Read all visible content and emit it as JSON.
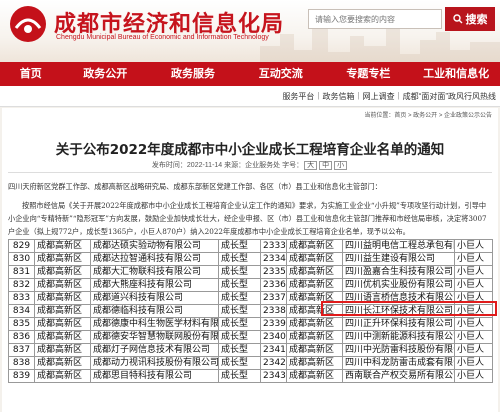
{
  "header": {
    "title": "成都市经济和信息化局",
    "subtitle": "Chengdu Municipal Bureau of Economic and Information Technology",
    "search_placeholder": "请输入您要搜索的内容",
    "search_button": "搜索"
  },
  "nav": [
    "首页",
    "政务公开",
    "政务服务",
    "互动交流",
    "专题专栏",
    "工业和信息化"
  ],
  "quick_links": [
    "服务平台",
    "政务信箱",
    "网上调查",
    "成都“面对面”政风行风热线"
  ],
  "breadcrumb": "当前位置：首页 > 政务公开 > 企业政策公示公告",
  "article": {
    "title": "关于公布2022年度成都市中小企业成长工程培育企业名单的通知",
    "meta_prefix": "发布时间：2022-11-14 来源：企业服务处 字号：",
    "font_sizes": [
      "大",
      "中",
      "小"
    ],
    "p1": "四川天府新区党群工作部、成都高新区战略研究局、成都东部新区党建工作部、各区（市）县工业和信息化主管部门：",
    "p2": "按照市经信局《关于开展2022年度成都市中小企业成长工程培育企业认定工作的通知》要求，为实施工业企业“小升规”专项攻坚行动计划，引导中小企业向“专精特新”“隐形冠军”方向发展，鼓励企业加快成长壮大，经企业申报、区（市）县工业和信息化主管部门推荐和市经信局审核，决定将3007户企业（拟上规772户，成长型1365户，小巨人870户）纳入2022年度成都市中小企业成长工程培育企业名单，现予以公布。"
  },
  "table": {
    "rows": [
      [
        "829",
        "成都高新区",
        "成都达硕实验动物有限公司",
        "成长型",
        "2333",
        "成都高新区",
        "四川益明电信工程总承包有限公司",
        "小巨人"
      ],
      [
        "830",
        "成都高新区",
        "成都达拉智通科技有限公司",
        "成长型",
        "2334",
        "成都高新区",
        "四川益生建设有限公司",
        "小巨人"
      ],
      [
        "831",
        "成都高新区",
        "成都大汇物联科技有限公司",
        "成长型",
        "2335",
        "成都高新区",
        "四川盈嘉合生科技有限公司",
        "小巨人"
      ],
      [
        "832",
        "成都高新区",
        "成都大熊座科技有限公司",
        "成长型",
        "2336",
        "成都高新区",
        "四川优机实业股份有限公司",
        "小巨人"
      ],
      [
        "833",
        "成都高新区",
        "成都道兴科技有限公司",
        "成长型",
        "2337",
        "成都高新区",
        "四川语言桥信息技术有限公司",
        "小巨人"
      ],
      [
        "834",
        "成都高新区",
        "成都德临科技有限公司",
        "成长型",
        "2338",
        "成都高新区",
        "四川长江环保技术有限公司",
        "小巨人"
      ],
      [
        "835",
        "成都高新区",
        "成都德康中科生物医学材料有限",
        "成长型",
        "2339",
        "成都高新区",
        "四川正升环保科技有限公司",
        "小巨人"
      ],
      [
        "836",
        "成都高新区",
        "成都德安华智慧物联网股份有限",
        "成长型",
        "2340",
        "成都高新区",
        "四川中测新能源科技有限公司",
        "小巨人"
      ],
      [
        "837",
        "成都高新区",
        "成都灯子网信息技术有限公司",
        "成长型",
        "2341",
        "成都高新区",
        "四川中光防雷科技股份有限公司",
        "小巨人"
      ],
      [
        "838",
        "成都高新区",
        "成都动力视讯科技股份有限公司",
        "成长型",
        "2342",
        "成都高新区",
        "四川中科龙防雷击成套有限公司",
        "小巨人"
      ],
      [
        "839",
        "成都高新区",
        "成都思目特科技有限公司",
        "成长型",
        "2343",
        "成都高新区",
        "西南联合产权交易所有限公司",
        "小巨人"
      ]
    ]
  },
  "colors": {
    "brand_red": "#c4111a",
    "highlight": "#e01b1b"
  }
}
